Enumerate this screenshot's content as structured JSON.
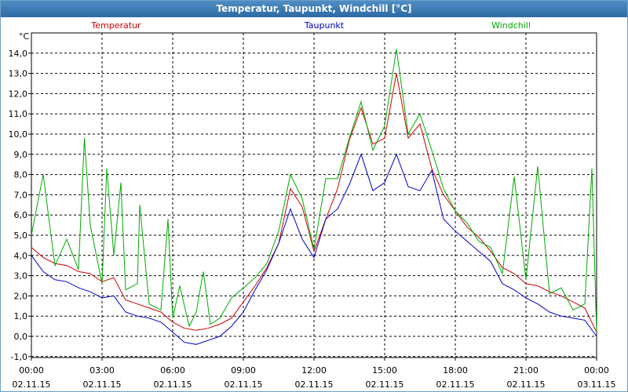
{
  "title": "Temperatur, Taupunkt, Windchill [°C]",
  "chart_data": {
    "type": "line",
    "title": "Temperatur, Taupunkt, Windchill [°C]",
    "ylabel": "°C",
    "ylim": [
      -1.0,
      14.5
    ],
    "yticks": [
      "-1,0",
      "0,0",
      "1,0",
      "2,0",
      "3,0",
      "4,0",
      "5,0",
      "6,0",
      "7,0",
      "8,0",
      "9,0",
      "10,0",
      "11,0",
      "12,0",
      "13,0",
      "14,0"
    ],
    "xlim_hours": [
      0,
      24
    ],
    "xticks": [
      {
        "time": "00:00",
        "date": "02.11.15"
      },
      {
        "time": "03:00",
        "date": "02.11.15"
      },
      {
        "time": "06:00",
        "date": "02.11.15"
      },
      {
        "time": "09:00",
        "date": "02.11.15"
      },
      {
        "time": "12:00",
        "date": "02.11.15"
      },
      {
        "time": "15:00",
        "date": "02.11.15"
      },
      {
        "time": "18:00",
        "date": "02.11.15"
      },
      {
        "time": "21:00",
        "date": "02.11.15"
      },
      {
        "time": "00:00",
        "date": "03.11.15"
      }
    ],
    "grid": true,
    "legend": "top",
    "colors": {
      "Temperatur": "#cc0000",
      "Taupunkt": "#0000cc",
      "Windchill": "#00aa00"
    },
    "series": [
      {
        "name": "Temperatur",
        "points": [
          [
            0,
            4.4
          ],
          [
            0.5,
            3.9
          ],
          [
            1,
            3.6
          ],
          [
            1.5,
            3.5
          ],
          [
            2,
            3.2
          ],
          [
            2.5,
            3.1
          ],
          [
            3,
            2.7
          ],
          [
            3.5,
            2.9
          ],
          [
            4,
            1.8
          ],
          [
            4.5,
            1.6
          ],
          [
            5,
            1.4
          ],
          [
            5.5,
            1.2
          ],
          [
            6,
            0.7
          ],
          [
            6.5,
            0.4
          ],
          [
            7,
            0.3
          ],
          [
            7.5,
            0.4
          ],
          [
            8,
            0.6
          ],
          [
            8.5,
            0.9
          ],
          [
            9,
            1.7
          ],
          [
            9.5,
            2.5
          ],
          [
            10,
            3.4
          ],
          [
            10.5,
            4.6
          ],
          [
            11,
            7.3
          ],
          [
            11.5,
            6.4
          ],
          [
            12,
            4.2
          ],
          [
            12.5,
            5.8
          ],
          [
            13,
            7.3
          ],
          [
            13.5,
            9.7
          ],
          [
            14,
            11.3
          ],
          [
            14.5,
            9.5
          ],
          [
            15,
            9.8
          ],
          [
            15.5,
            13.0
          ],
          [
            16,
            9.8
          ],
          [
            16.5,
            10.5
          ],
          [
            17,
            8.3
          ],
          [
            17.5,
            7.0
          ],
          [
            18,
            6.2
          ],
          [
            18.5,
            5.4
          ],
          [
            19,
            4.9
          ],
          [
            19.5,
            4.2
          ],
          [
            20,
            3.4
          ],
          [
            20.5,
            3.1
          ],
          [
            21,
            2.6
          ],
          [
            21.5,
            2.5
          ],
          [
            22,
            2.2
          ],
          [
            22.5,
            2.0
          ],
          [
            23,
            1.7
          ],
          [
            23.5,
            1.4
          ],
          [
            24,
            0.2
          ]
        ]
      },
      {
        "name": "Taupunkt",
        "points": [
          [
            0,
            4.0
          ],
          [
            0.5,
            3.2
          ],
          [
            1,
            2.8
          ],
          [
            1.5,
            2.7
          ],
          [
            2,
            2.4
          ],
          [
            2.5,
            2.2
          ],
          [
            3,
            1.9
          ],
          [
            3.5,
            2.0
          ],
          [
            4,
            1.2
          ],
          [
            4.5,
            1.0
          ],
          [
            5,
            0.9
          ],
          [
            5.5,
            0.7
          ],
          [
            6,
            0.2
          ],
          [
            6.5,
            -0.3
          ],
          [
            7,
            -0.4
          ],
          [
            7.5,
            -0.2
          ],
          [
            8,
            0.0
          ],
          [
            8.5,
            0.5
          ],
          [
            9,
            1.2
          ],
          [
            9.5,
            2.3
          ],
          [
            10,
            3.3
          ],
          [
            10.5,
            4.6
          ],
          [
            11,
            6.3
          ],
          [
            11.5,
            4.8
          ],
          [
            12,
            3.9
          ],
          [
            12.5,
            5.8
          ],
          [
            13,
            6.3
          ],
          [
            13.5,
            7.5
          ],
          [
            14,
            9.0
          ],
          [
            14.5,
            7.2
          ],
          [
            15,
            7.6
          ],
          [
            15.5,
            9.0
          ],
          [
            16,
            7.4
          ],
          [
            16.5,
            7.2
          ],
          [
            17,
            8.2
          ],
          [
            17.5,
            5.8
          ],
          [
            18,
            5.2
          ],
          [
            18.5,
            4.7
          ],
          [
            19,
            4.2
          ],
          [
            19.5,
            3.7
          ],
          [
            20,
            2.6
          ],
          [
            20.5,
            2.3
          ],
          [
            21,
            1.9
          ],
          [
            21.5,
            1.6
          ],
          [
            22,
            1.2
          ],
          [
            22.5,
            1.0
          ],
          [
            23,
            0.9
          ],
          [
            23.5,
            0.8
          ],
          [
            24,
            0.0
          ]
        ]
      },
      {
        "name": "Windchill",
        "points": [
          [
            0,
            5.0
          ],
          [
            0.5,
            8.0
          ],
          [
            1,
            3.5
          ],
          [
            1.5,
            4.8
          ],
          [
            2,
            3.3
          ],
          [
            2.25,
            9.8
          ],
          [
            2.5,
            5.5
          ],
          [
            3,
            2.6
          ],
          [
            3.2,
            8.3
          ],
          [
            3.5,
            4.0
          ],
          [
            3.8,
            7.6
          ],
          [
            4,
            2.3
          ],
          [
            4.5,
            2.6
          ],
          [
            4.6,
            6.5
          ],
          [
            5,
            1.6
          ],
          [
            5.5,
            1.3
          ],
          [
            5.8,
            5.8
          ],
          [
            6,
            0.9
          ],
          [
            6.3,
            2.5
          ],
          [
            6.7,
            0.5
          ],
          [
            7,
            1.2
          ],
          [
            7.3,
            3.2
          ],
          [
            7.6,
            0.6
          ],
          [
            8,
            0.9
          ],
          [
            8.5,
            1.9
          ],
          [
            9,
            2.4
          ],
          [
            9.5,
            2.9
          ],
          [
            10,
            3.6
          ],
          [
            10.5,
            5.2
          ],
          [
            11,
            8.0
          ],
          [
            11.5,
            6.8
          ],
          [
            12,
            4.3
          ],
          [
            12.5,
            7.8
          ],
          [
            13,
            7.8
          ],
          [
            13.5,
            9.8
          ],
          [
            14,
            11.6
          ],
          [
            14.5,
            9.2
          ],
          [
            15,
            10.4
          ],
          [
            15.5,
            14.2
          ],
          [
            16,
            10.0
          ],
          [
            16.5,
            11.0
          ],
          [
            17,
            9.2
          ],
          [
            17.5,
            7.3
          ],
          [
            18,
            6.2
          ],
          [
            18.5,
            5.6
          ],
          [
            19,
            4.7
          ],
          [
            19.5,
            4.4
          ],
          [
            20,
            3.1
          ],
          [
            20.5,
            7.9
          ],
          [
            21,
            2.8
          ],
          [
            21.5,
            8.4
          ],
          [
            22,
            2.1
          ],
          [
            22.5,
            2.4
          ],
          [
            23,
            1.3
          ],
          [
            23.5,
            1.6
          ],
          [
            23.8,
            8.3
          ],
          [
            24,
            0.2
          ]
        ]
      }
    ]
  }
}
